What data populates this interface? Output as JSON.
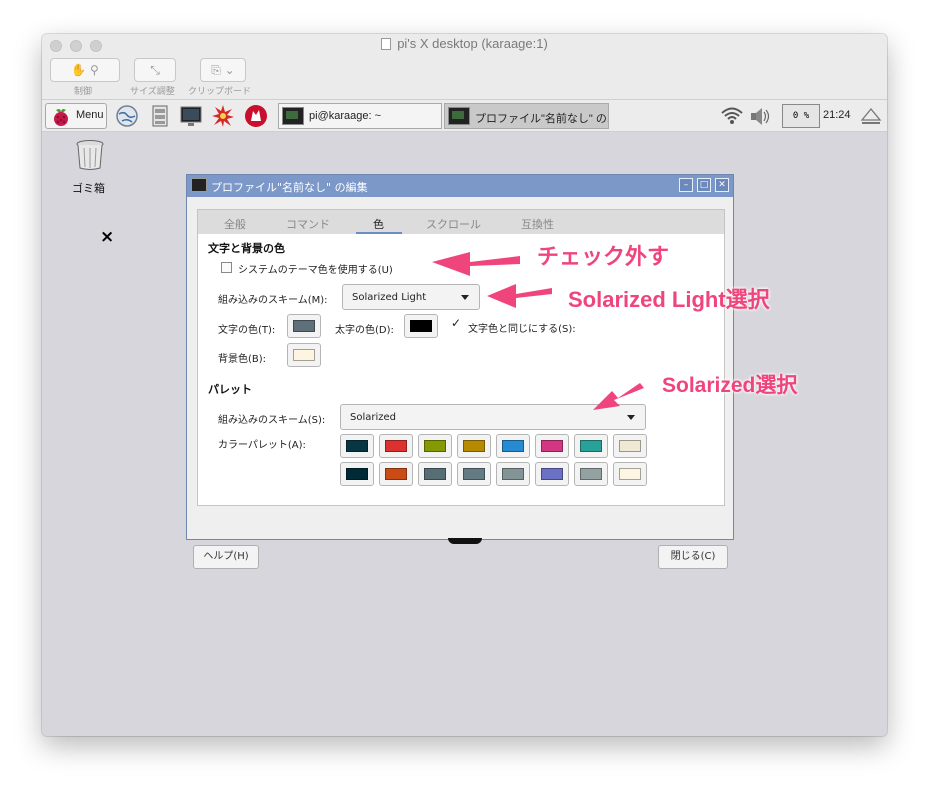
{
  "window": {
    "title": "pi's X desktop (karaage:1)",
    "toolbar": {
      "control_label": "制御",
      "resize_label": "サイズ調整",
      "clipboard_label": "クリップボード"
    }
  },
  "panel": {
    "menu_label": "Menu",
    "task1": "pi@karaage: ~",
    "task2": "プロファイル\"名前なし\" の...",
    "cpu": "0 %",
    "clock": "21:24"
  },
  "desktop": {
    "trash_label": "ゴミ箱",
    "close_mark": "×"
  },
  "dialog": {
    "title": "プロファイル\"名前なし\" の編集",
    "tabs": [
      {
        "label": "全般"
      },
      {
        "label": "コマンド"
      },
      {
        "label": "色"
      },
      {
        "label": "スクロール"
      },
      {
        "label": "互換性"
      }
    ],
    "selected_tab": "色",
    "text_bg": {
      "header": "文字と背景の色",
      "use_theme_label": "システムのテーマ色を使用する(U)",
      "use_theme_checked": false,
      "scheme_label": "組み込みのスキーム(M):",
      "scheme_value": "Solarized Light",
      "text_color_label": "文字の色(T):",
      "text_color": "#5f707a",
      "bold_color_label": "太字の色(D):",
      "bold_color": "#000000",
      "same_as_text_label": "文字色と同じにする(S):",
      "same_as_text_checked": true,
      "bg_color_label": "背景色(B):",
      "bg_color": "#fdf5e2"
    },
    "palette": {
      "header": "パレット",
      "scheme_label": "組み込みのスキーム(S):",
      "scheme_value": "Solarized",
      "palette_label": "カラーパレット(A):",
      "row1": [
        "#073642",
        "#dc322f",
        "#859900",
        "#b58900",
        "#268bd2",
        "#d33682",
        "#2aa198",
        "#eee8d5"
      ],
      "row2": [
        "#002b36",
        "#cb4b16",
        "#586e75",
        "#657b83",
        "#839496",
        "#6c71c4",
        "#93a1a1",
        "#fdf6e3"
      ]
    },
    "help_button": "ヘルプ(H)",
    "close_button": "閉じる(C)"
  },
  "annotations": {
    "uncheck": "チェック外す",
    "light": "Solarized Light選択",
    "solarized": "Solarized選択",
    "color": "#f0457c"
  }
}
